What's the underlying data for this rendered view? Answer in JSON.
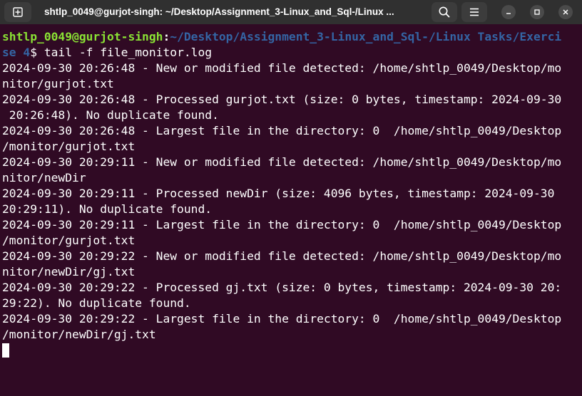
{
  "window": {
    "title": "shtlp_0049@gurjot-singh: ~/Desktop/Assignment_3-Linux_and_Sql-/Linux ..."
  },
  "icons": {
    "new_tab": "new-tab-icon",
    "search": "search-icon",
    "menu": "hamburger-menu-icon",
    "minimize": "minimize-icon",
    "maximize": "maximize-icon",
    "close": "close-icon"
  },
  "colors": {
    "background": "#300a24",
    "titlebar": "#303030",
    "prompt_user": "#8ae234",
    "prompt_path": "#3465a4",
    "text": "#ffffff"
  },
  "terminal": {
    "prompt": {
      "user_host": "shtlp_0049@gurjot-singh",
      "colon": ":",
      "path_part1": "~/Desktop/Assignment_3-Linux_and_Sql-/Linux Tasks/Exerci",
      "path_part2": "se 4",
      "symbol": "$ ",
      "command": "tail -f file_monitor.log"
    },
    "lines": [
      "2024-09-30 20:26:48 - New or modified file detected: /home/shtlp_0049/Desktop/mo",
      "nitor/gurjot.txt",
      "2024-09-30 20:26:48 - Processed gurjot.txt (size: 0 bytes, timestamp: 2024-09-30",
      " 20:26:48). No duplicate found.",
      "2024-09-30 20:26:48 - Largest file in the directory: 0  /home/shtlp_0049/Desktop",
      "/monitor/gurjot.txt",
      "2024-09-30 20:29:11 - New or modified file detected: /home/shtlp_0049/Desktop/mo",
      "nitor/newDir",
      "2024-09-30 20:29:11 - Processed newDir (size: 4096 bytes, timestamp: 2024-09-30",
      "20:29:11). No duplicate found.",
      "2024-09-30 20:29:11 - Largest file in the directory: 0  /home/shtlp_0049/Desktop",
      "/monitor/gurjot.txt",
      "2024-09-30 20:29:22 - New or modified file detected: /home/shtlp_0049/Desktop/mo",
      "nitor/newDir/gj.txt",
      "2024-09-30 20:29:22 - Processed gj.txt (size: 0 bytes, timestamp: 2024-09-30 20:",
      "29:22). No duplicate found.",
      "2024-09-30 20:29:22 - Largest file in the directory: 0  /home/shtlp_0049/Desktop",
      "/monitor/newDir/gj.txt"
    ]
  }
}
